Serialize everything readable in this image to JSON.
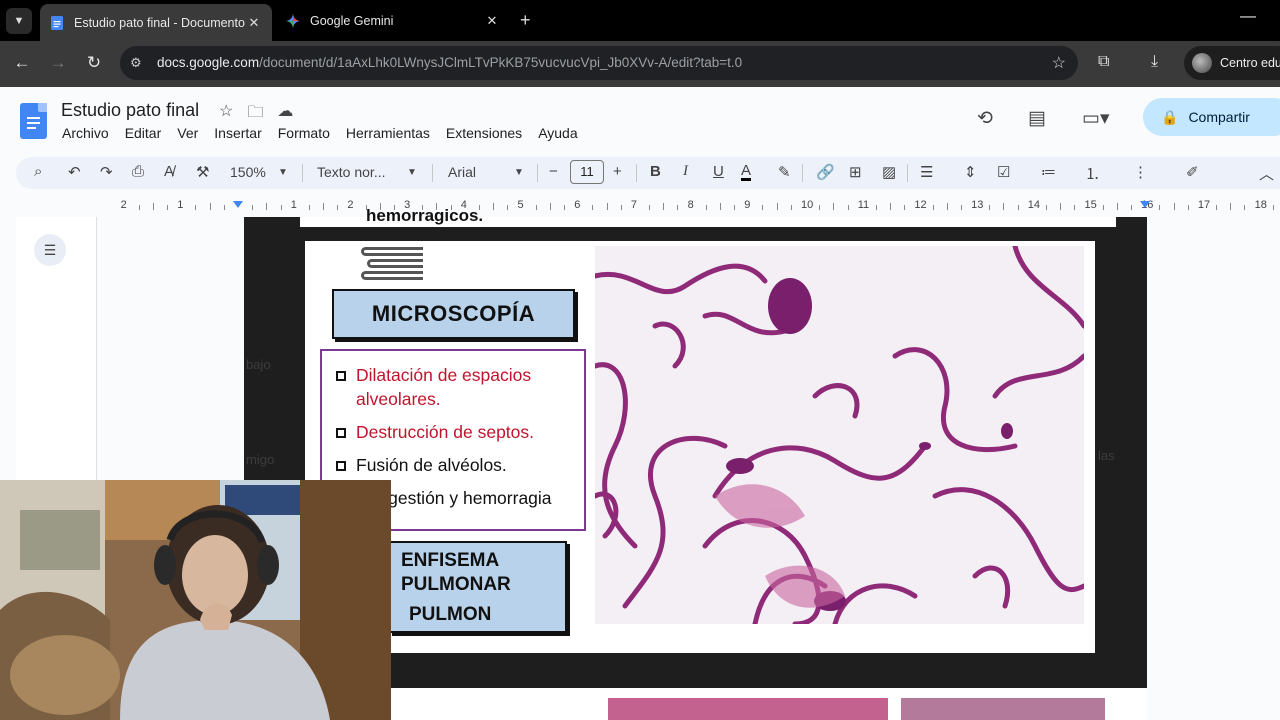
{
  "browser": {
    "tabs": [
      {
        "title": "Estudio pato final - Documento",
        "active": true
      },
      {
        "title": "Google Gemini",
        "active": false
      }
    ],
    "url_host": "docs.google.com",
    "url_path": "/document/d/1aAxLhk0LWnysJClmLTvPkKB75vucvucVpi_Jb0XVv-A/edit?tab=t.0",
    "profile_label": "Centro edu"
  },
  "docs": {
    "title": "Estudio pato final",
    "menu": [
      "Archivo",
      "Editar",
      "Ver",
      "Insertar",
      "Formato",
      "Herramientas",
      "Extensiones",
      "Ayuda"
    ],
    "share_label": "Compartir",
    "toolbar": {
      "zoom": "150%",
      "style": "Texto nor...",
      "font": "Arial",
      "font_size": "11"
    },
    "ruler_numbers": [
      "2",
      "1",
      "1",
      "2",
      "3",
      "4",
      "5",
      "6",
      "7",
      "8",
      "9",
      "10",
      "11",
      "12",
      "13",
      "14",
      "15",
      "16",
      "17",
      "18"
    ]
  },
  "document": {
    "top_text": "hemorragicos.",
    "slide": {
      "header": "MICROSCOPÍA",
      "items": [
        {
          "text": "Dilatación de espacios alveolares.",
          "color": "red"
        },
        {
          "text": "Destrucción de septos.",
          "color": "red"
        },
        {
          "text": "Fusión de alvéolos.",
          "color": "black"
        },
        {
          "text": "Congestión y hemorragia",
          "color": "black"
        }
      ],
      "footer_lines": [
        "ENFISEMA",
        "PULMONAR",
        "PULMON"
      ]
    }
  },
  "colors": {
    "accent": "#4285f4",
    "share_bg": "#c2e7ff",
    "slide_box": "#b8d2ec",
    "list_border": "#7a3b95",
    "red_text": "#c0142c"
  }
}
